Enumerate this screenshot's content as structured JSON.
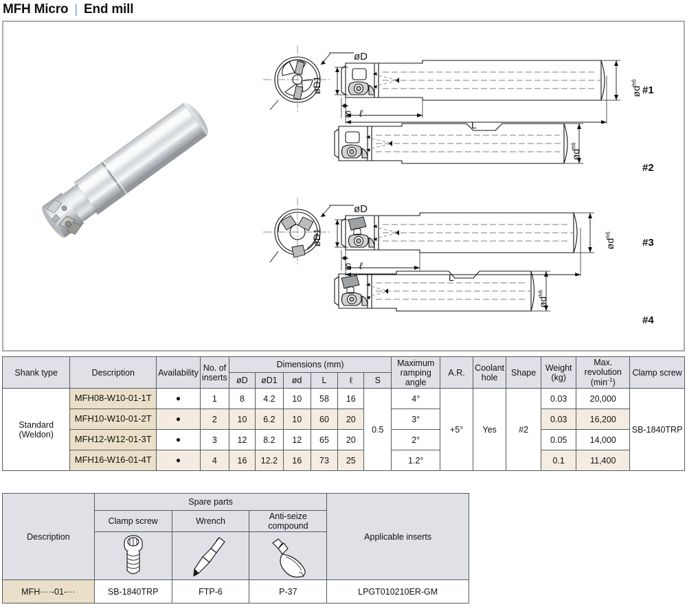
{
  "title": {
    "main": "MFH Micro",
    "separator": "|",
    "sub": "End mill"
  },
  "figure": {
    "variants": [
      "#1",
      "#2",
      "#3",
      "#4"
    ],
    "labels": {
      "oD": "øD",
      "oD1": "øD1",
      "od_h6": "ød",
      "h6": "h6",
      "S": "S",
      "l": "ℓ",
      "L": "L"
    },
    "photo_alt": "MFH Micro end mill tool photo"
  },
  "main_table": {
    "headers": {
      "shank_type": "Shank type",
      "description": "Description",
      "availability": "Availability",
      "no_of_inserts": "No. of\ninserts",
      "dimensions": "Dimensions (mm)",
      "oD": "øD",
      "oD1": "øD1",
      "od": "ød",
      "L": "L",
      "l": "ℓ",
      "S": "S",
      "max_ramping_angle": "Maximum\nramping\nangle",
      "ar": "A.R.",
      "coolant_hole": "Coolant\nhole",
      "shape": "Shape",
      "weight": "Weight\n(kg)",
      "max_revolution": "Max.\nrevolution\n(min",
      "max_revolution_sup": "-1",
      "max_revolution_tail": ")",
      "clamp_screw": "Clamp screw"
    },
    "shank_type_value": "Standard\n(Weldon)",
    "shank_type_line1": "Standard",
    "shank_type_line2": "(Weldon)",
    "s_value": "0.5",
    "ar_value": "+5°",
    "coolant_hole_value": "Yes",
    "shape_value": "#2",
    "clamp_screw_value": "SB-1840TRP",
    "rows": [
      {
        "description": "MFH08-W10-01-1T",
        "availability": "●",
        "inserts": "1",
        "oD": "8",
        "oD1": "4.2",
        "od": "10",
        "L": "58",
        "l": "16",
        "ramping_angle": "4°",
        "weight": "0.03",
        "max_revolution": "20,000"
      },
      {
        "description": "MFH10-W10-01-2T",
        "availability": "●",
        "inserts": "2",
        "oD": "10",
        "oD1": "6.2",
        "od": "10",
        "L": "60",
        "l": "20",
        "ramping_angle": "3°",
        "weight": "0.03",
        "max_revolution": "16,200"
      },
      {
        "description": "MFH12-W12-01-3T",
        "availability": "●",
        "inserts": "3",
        "oD": "12",
        "oD1": "8.2",
        "od": "12",
        "L": "65",
        "l": "20",
        "ramping_angle": "2°",
        "weight": "0.05",
        "max_revolution": "14,000"
      },
      {
        "description": "MFH16-W16-01-4T",
        "availability": "●",
        "inserts": "4",
        "oD": "16",
        "oD1": "12.2",
        "od": "16",
        "L": "73",
        "l": "25",
        "ramping_angle": "1.2°",
        "weight": "0.1",
        "max_revolution": "11,400"
      }
    ]
  },
  "spare_table": {
    "headers": {
      "description": "Description",
      "spare_parts": "Spare parts",
      "clamp_screw": "Clamp screw",
      "wrench": "Wrench",
      "anti_seize": "Anti-seize compound",
      "applicable_inserts": "Applicable inserts"
    },
    "icons": {
      "clamp_screw": "screw-icon",
      "wrench": "wrench-icon",
      "anti_seize": "tube-icon"
    },
    "row": {
      "description": "MFH····-01-···",
      "clamp_screw": "SB-1840TRP",
      "wrench": "FTP-6",
      "anti_seize": "P-37",
      "applicable_inserts": "LPGT010210ER-GM"
    }
  },
  "colors": {
    "accent": "#6f9fd8",
    "header_bg": "#dfe1e7",
    "tan_dark": "#eadfc8",
    "tan_light": "#f4ece0",
    "border": "#555a5e"
  }
}
